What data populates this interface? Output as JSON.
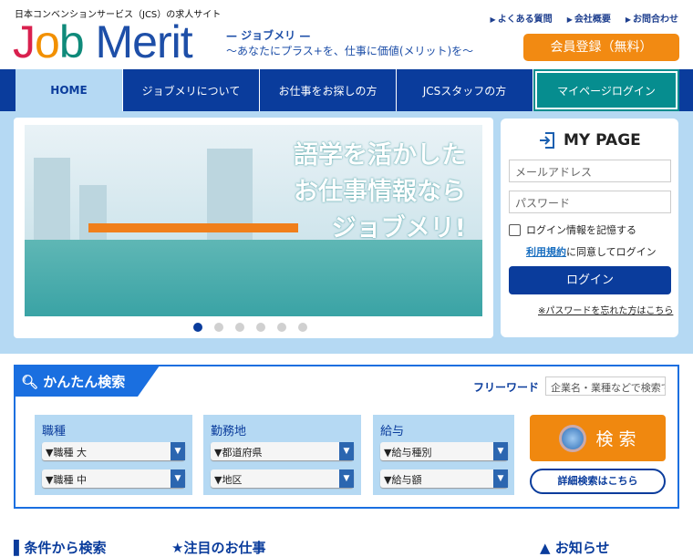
{
  "header": {
    "tagline": "日本コンベンションサービス（JCS）の求人サイト",
    "logo": {
      "j": "J",
      "o": "o",
      "b": "b",
      "rest": " Merit"
    },
    "subtitle1": "— ジョブメリ —",
    "subtitle2": "〜あなたにプラス+を、仕事に価値(メリット)を〜",
    "links": [
      "よくある質問",
      "会社概要",
      "お問合わせ"
    ],
    "register": "会員登録（無料）"
  },
  "nav": {
    "items": [
      "HOME",
      "ジョブメリについて",
      "お仕事をお探しの方",
      "JCSスタッフの方"
    ],
    "mypage": "マイページログイン"
  },
  "banner": {
    "lines": [
      "語学を活かした",
      "お仕事情報なら",
      "ジョブメリ!"
    ],
    "slide_count": 6,
    "active_slide": 1
  },
  "login": {
    "title": "MY PAGE",
    "email_placeholder": "メールアドレス",
    "password_placeholder": "パスワード",
    "remember": "ログイン情報を記憶する",
    "terms_link": "利用規約",
    "terms_text": "に同意してログイン",
    "button": "ログイン",
    "forgot": "※パスワードを忘れた方はこちら"
  },
  "search": {
    "title": "かんたん検索",
    "freeword_label": "フリーワード",
    "freeword_placeholder": "企業名・業種などで検索できます",
    "panels": [
      {
        "title": "職種",
        "selects": [
          "▼職種 大",
          "▼職種 中"
        ]
      },
      {
        "title": "勤務地",
        "selects": [
          "▼都道府県",
          "▼地区"
        ]
      },
      {
        "title": "給与",
        "selects": [
          "▼給与種別",
          "▼給与額"
        ]
      }
    ],
    "button": "検 索",
    "detail": "詳細検索はこちら"
  },
  "sections": [
    "条件から検索",
    "注目のお仕事",
    "お知らせ"
  ]
}
